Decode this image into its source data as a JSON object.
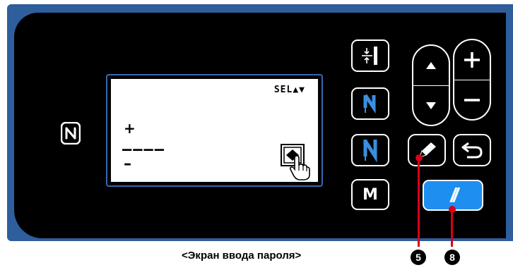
{
  "lcd": {
    "sel_label": "SEL▲▼",
    "plus_symbol": "+",
    "password_mask": "––––",
    "minus_symbol": "–"
  },
  "buttons": {
    "m_label": "M",
    "reset_label": "//"
  },
  "callouts": {
    "pencil_number": "5",
    "reset_number": "8"
  },
  "caption": "<Экран ввода пароля>",
  "icons": {
    "nfc": "nfc-icon",
    "edge": "needle-edge-icon",
    "reverse": "reverse-feed-icon",
    "n": "n-stitch-icon",
    "pencil": "pencil-icon",
    "return": "return-icon",
    "up": "triangle-up-icon",
    "down": "triangle-down-icon",
    "plus": "plus-icon",
    "minus": "minus-icon"
  },
  "colors": {
    "panel": "#2e5e9c",
    "reset_button": "#1e8ff0",
    "callout": "#d9001b"
  }
}
